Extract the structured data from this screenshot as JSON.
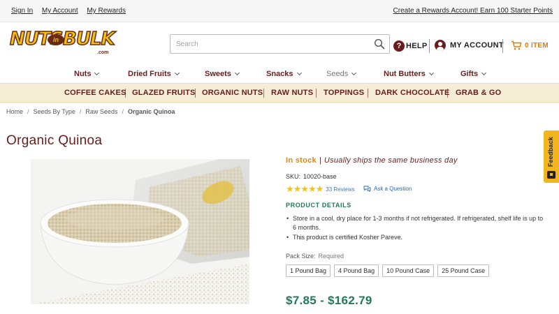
{
  "topbar": {
    "links": [
      "Sign In",
      "My Account",
      "My Rewards"
    ],
    "promo": "Create a Rewards Account! Earn 100 Starter Points"
  },
  "logo": {
    "part1": "NUTS",
    "connector": "in",
    "part2": "BULK",
    "suffix": ".com"
  },
  "search": {
    "placeholder": "Search",
    "value": ""
  },
  "header": {
    "help": "HELP",
    "account": "MY ACCOUNT",
    "cart": "0 ITEM"
  },
  "mainnav": [
    "Nuts",
    "Dried Fruits",
    "Sweets",
    "Snacks",
    "Seeds",
    "Nut Butters",
    "Gifts"
  ],
  "categories": [
    "COFFEE CAKES",
    "GLAZED FRUITS",
    "ORGANIC NUTS",
    "RAW NUTS",
    "TOPPINGS",
    "DARK CHOCOLATE",
    "GRAB & GO"
  ],
  "breadcrumb": [
    "Home",
    "Seeds By Type",
    "Raw Seeds",
    "Organic Quinoa"
  ],
  "product": {
    "title": "Organic Quinoa",
    "stock": "In stock",
    "shipping": "Usually ships the same business day",
    "sku_label": "SKU:",
    "sku": "10020-base",
    "rating": 5,
    "stars": "★★★★★",
    "reviews": "33 Reviews",
    "ask": "Ask a Question",
    "details_heading": "PRODUCT DETAILS",
    "details": [
      "Store in a cool, dry place for 1-3 months if not refrigerated. If refrigerated, shelf life is up to 6 months.",
      "This product is certified Kosher Pareve."
    ],
    "pack_label": "Pack Size:",
    "pack_required": "Required",
    "packs": [
      "1 Pound Bag",
      "4 Pound Bag",
      "10 Pound Case",
      "25 Pound Case"
    ],
    "price": "$7.85 - $162.79"
  },
  "feedback": "Feedback",
  "colors": {
    "brand": "#6a1b1b",
    "green": "#1f7a55",
    "orange": "#e07b00",
    "band": "#f5ecd5",
    "feedback": "#f2b51e"
  }
}
